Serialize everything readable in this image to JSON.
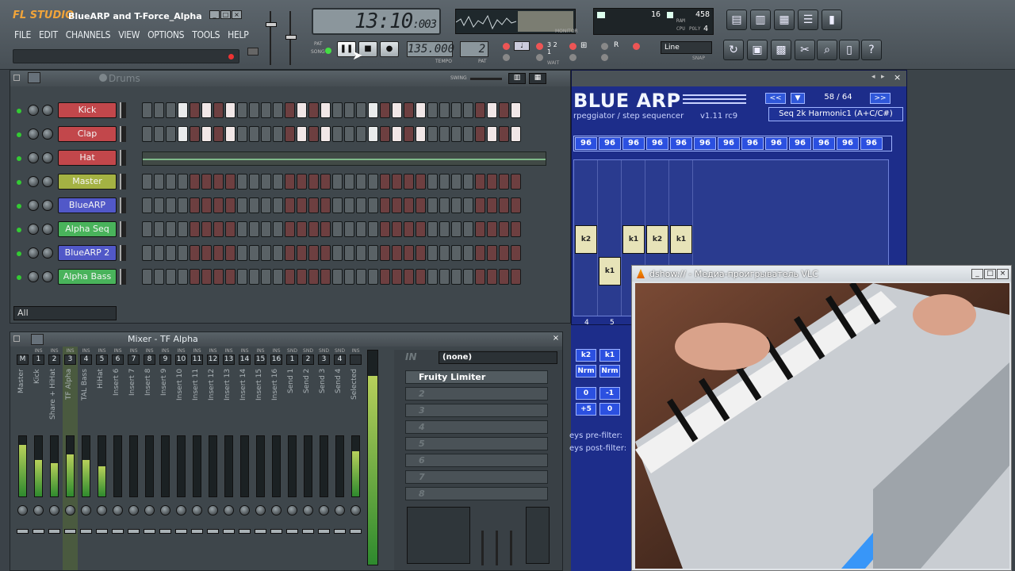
{
  "window": {
    "logo": "FL STUDIO",
    "title": "BlueARP and T-Force_Alpha T..."
  },
  "menu": [
    "FILE",
    "EDIT",
    "CHANNELS",
    "VIEW",
    "OPTIONS",
    "TOOLS",
    "HELP"
  ],
  "transport": {
    "time_main": "13:10",
    "time_ticks": ":003",
    "tempo": "135.000",
    "tempo_label": "TEMPO",
    "pattern": "2",
    "pat_label": "PAT",
    "pat_song": [
      "PAT",
      "SONG"
    ],
    "monitor_label": "MONITOR",
    "cpu": {
      "left": "16",
      "right": "458",
      "ram_label": "RAM",
      "cpu_label": "CPU",
      "poly_label": "POLY",
      "poly": "4"
    },
    "snap_value": "Line",
    "snap_label": "SNAP",
    "wait_label": "WAIT"
  },
  "sequencer": {
    "title": "Drums",
    "swing_label": "SWING",
    "filter": "All",
    "channels": [
      {
        "name": "Kick",
        "color": "#c2474b",
        "steps": "w.ww.w.ww.w.ww.w"
      },
      {
        "name": "Clap",
        "color": "#c2474b",
        "steps": "w.ww.w.ww.w.ww.w"
      },
      {
        "name": "Hat",
        "color": "#c2474b",
        "steps": "hat"
      },
      {
        "name": "Master",
        "color": "#a4b243",
        "steps": ""
      },
      {
        "name": "BlueARP",
        "color": "#5158c8",
        "steps": ""
      },
      {
        "name": "Alpha Seq",
        "color": "#49b35b",
        "steps": ""
      },
      {
        "name": "BlueARP 2",
        "color": "#5158c8",
        "steps": ""
      },
      {
        "name": "Alpha Bass",
        "color": "#49b35b",
        "steps": ""
      }
    ]
  },
  "mixer": {
    "title": "Mixer - TF Alpha",
    "ins_label": "INS",
    "snd_label": "SND",
    "tracks": [
      {
        "num": "M",
        "name": "Master",
        "level": 0.85
      },
      {
        "num": "1",
        "name": "Kick",
        "level": 0.6
      },
      {
        "num": "2",
        "name": "Share + HiHat",
        "level": 0.55
      },
      {
        "num": "3",
        "name": "TF Alpha",
        "level": 0.7
      },
      {
        "num": "4",
        "name": "TAL Bass",
        "level": 0.6
      },
      {
        "num": "5",
        "name": "HiHat",
        "level": 0.5
      },
      {
        "num": "6",
        "name": "Insert 6",
        "level": 0
      },
      {
        "num": "7",
        "name": "Insert 7",
        "level": 0
      },
      {
        "num": "8",
        "name": "Insert 8",
        "level": 0
      },
      {
        "num": "9",
        "name": "Insert 9",
        "level": 0
      },
      {
        "num": "10",
        "name": "Insert 10",
        "level": 0
      },
      {
        "num": "11",
        "name": "Insert 11",
        "level": 0
      },
      {
        "num": "12",
        "name": "Insert 12",
        "level": 0
      },
      {
        "num": "13",
        "name": "Insert 13",
        "level": 0
      },
      {
        "num": "14",
        "name": "Insert 14",
        "level": 0
      },
      {
        "num": "15",
        "name": "Insert 15",
        "level": 0
      },
      {
        "num": "16",
        "name": "Insert 16",
        "level": 0
      },
      {
        "num": "1",
        "name": "Send 1",
        "level": 0
      },
      {
        "num": "2",
        "name": "Send 2",
        "level": 0
      },
      {
        "num": "3",
        "name": "Send 3",
        "level": 0
      },
      {
        "num": "4",
        "name": "Send 4",
        "level": 0
      },
      {
        "num": "",
        "name": "Selected",
        "level": 0.75
      }
    ],
    "fx": {
      "in_label": "IN",
      "input": "(none)",
      "slots": [
        "Fruity Limiter",
        "2",
        "3",
        "4",
        "5",
        "6",
        "7",
        "8"
      ]
    }
  },
  "bluearp": {
    "title": "BLUE ARP",
    "subtitle": "rpeggiator / step sequencer",
    "version": "v1.11 rc9",
    "nav_prev": "<<",
    "nav_down": "▼",
    "nav_next": ">>",
    "count": "58 / 64",
    "preset": "Seq 2k Harmonic1 (A+C/C#)",
    "velocities": [
      "96",
      "96",
      "96",
      "96",
      "96",
      "96",
      "96",
      "96",
      "96",
      "96",
      "96",
      "96",
      "96"
    ],
    "col_labels": [
      "4",
      "5"
    ],
    "cells": [
      {
        "col": 0,
        "row": 2,
        "text": "k2"
      },
      {
        "col": 2,
        "row": 2,
        "text": "k1"
      },
      {
        "col": 3,
        "row": 2,
        "text": "k2"
      },
      {
        "col": 4,
        "row": 2,
        "text": "k1"
      },
      {
        "col": 1,
        "row": 3,
        "text": "k1"
      }
    ],
    "lower_keys": [
      "k2",
      "k1"
    ],
    "lower_mode": [
      "Nrm",
      "Nrm"
    ],
    "lower_vals1": [
      "0",
      "-1"
    ],
    "lower_vals2": [
      "+5",
      "0"
    ],
    "keys_pre": "eys pre-filter:",
    "keys_post": "eys post-filter:"
  },
  "vlc": {
    "title": "dshow:// - Медиа-проигрыватель VLC"
  }
}
